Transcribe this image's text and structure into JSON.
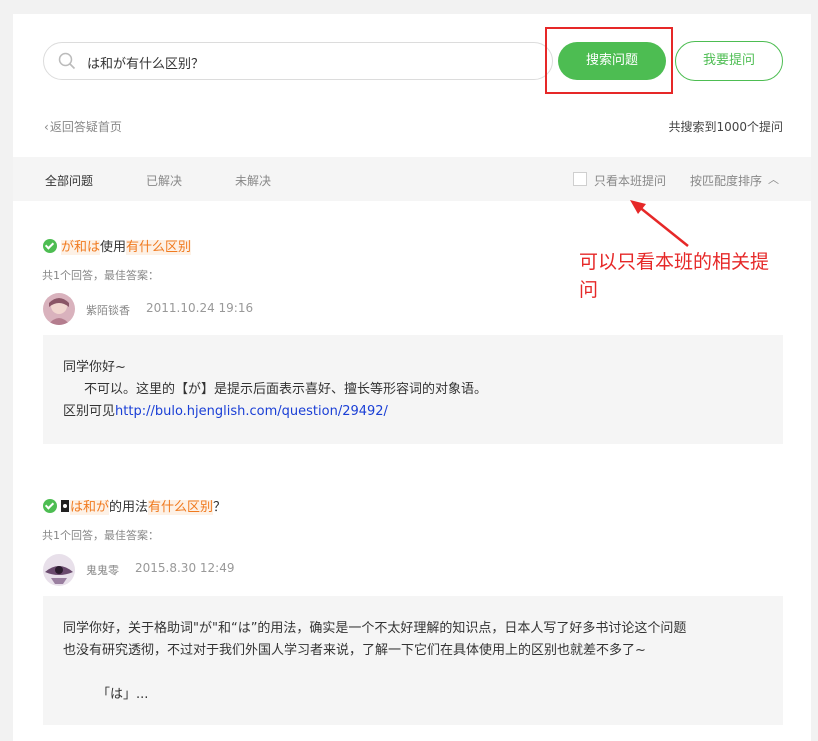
{
  "search": {
    "query": "は和が有什么区别？",
    "button_label": "搜索问题",
    "ask_label": "我要提问"
  },
  "nav": {
    "back_label": "返回答疑首页",
    "total_label": "共搜索到1000个提问"
  },
  "filters": {
    "tabs": [
      "全部问题",
      "已解决",
      "未解决"
    ],
    "class_only_label": "只看本班提问",
    "sort_label": "按匹配度排序"
  },
  "annotation": {
    "text": "可以只看本班的相关提问"
  },
  "questions": [
    {
      "title_parts": [
        "が和は",
        "使用",
        "有什么区别"
      ],
      "meta": "共1个回答，最佳答案：",
      "user": "紫陌锬香",
      "date": "2011.10.24 19:16",
      "answer_lines": [
        "同学你好~",
        "不可以。这里的【が】是提示后面表示喜好、擅长等形容词的对象语。",
        "区别可见"
      ],
      "answer_link": "http://bulo.hjenglish.com/question/29492/"
    },
    {
      "title_parts": [
        "は和が",
        "的用法",
        "有什么区别",
        "？"
      ],
      "meta": "共1个回答，最佳答案：",
      "user": "鬼鬼零",
      "date": "2015.8.30 12:49",
      "answer_lines": [
        "同学你好，关于格助词\"が\"和“は”的用法，确实是一个不太好理解的知识点，日本人写了好多书讨论这个问题",
        "也没有研究透彻，不过对于我们外国人学习者来说，了解一下它们在具体使用上的区别也就差不多了~",
        "「は」..."
      ]
    }
  ],
  "colors": {
    "accent": "#4dbd52",
    "highlight": "#f07a1f",
    "annotation": "#e62828",
    "link": "#1a3fd6"
  }
}
